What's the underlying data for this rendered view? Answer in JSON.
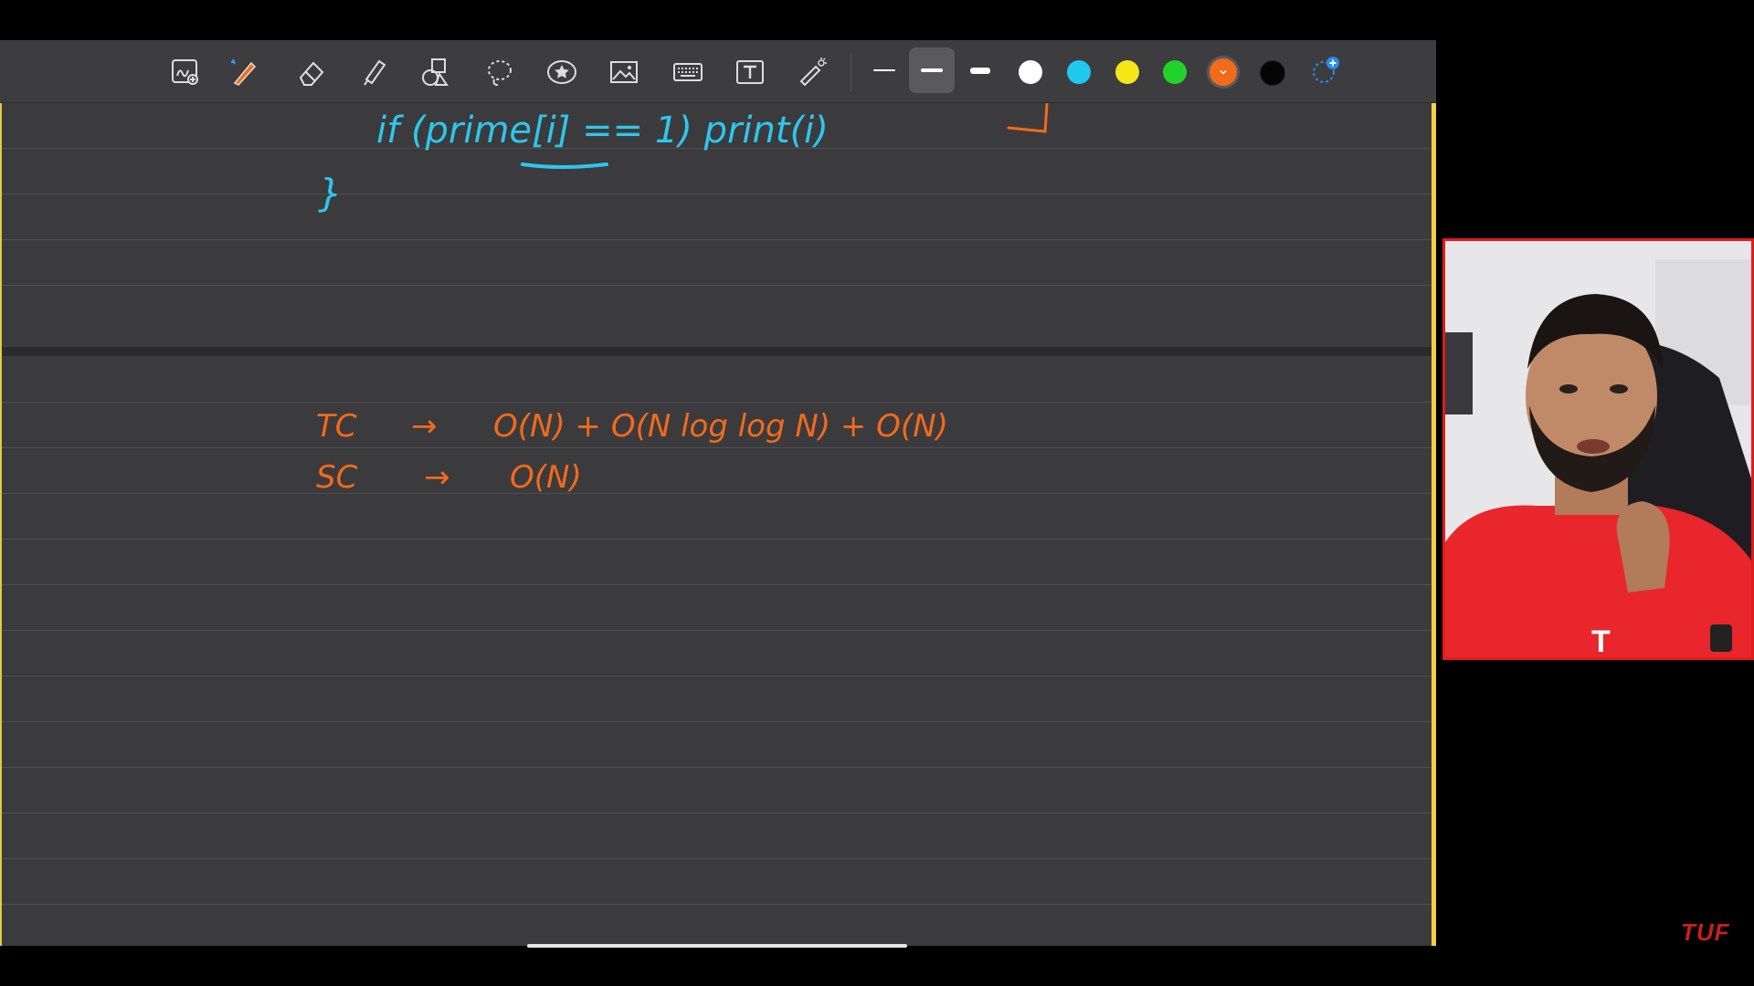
{
  "toolbar": {
    "tools": [
      "scribble-zoom",
      "pen",
      "eraser",
      "highlighter",
      "shapes",
      "lasso",
      "sticker",
      "image",
      "keyboard",
      "text",
      "laser-pointer"
    ],
    "stroke_widths": [
      "thin",
      "medium",
      "thick"
    ],
    "selected_stroke": "medium",
    "colors": [
      "#ffffff",
      "#20c8f0",
      "#f5e618",
      "#22d22c",
      "#f26a1b",
      "#000000"
    ],
    "selected_color": "#f26a1b",
    "add_color_icon": "plus-icon"
  },
  "notes": {
    "code_line": "if (prime[i] == 1) print(i)",
    "closing_brace": "}",
    "time_label": "TC",
    "time_complexity": "O(N) + O(N log log N) + O(N)",
    "space_label": "SC",
    "space_complexity": "O(N)",
    "arrow": "→"
  },
  "webcam": {
    "presenter": "presenter video"
  },
  "brand": {
    "logo_text": "TUF"
  }
}
